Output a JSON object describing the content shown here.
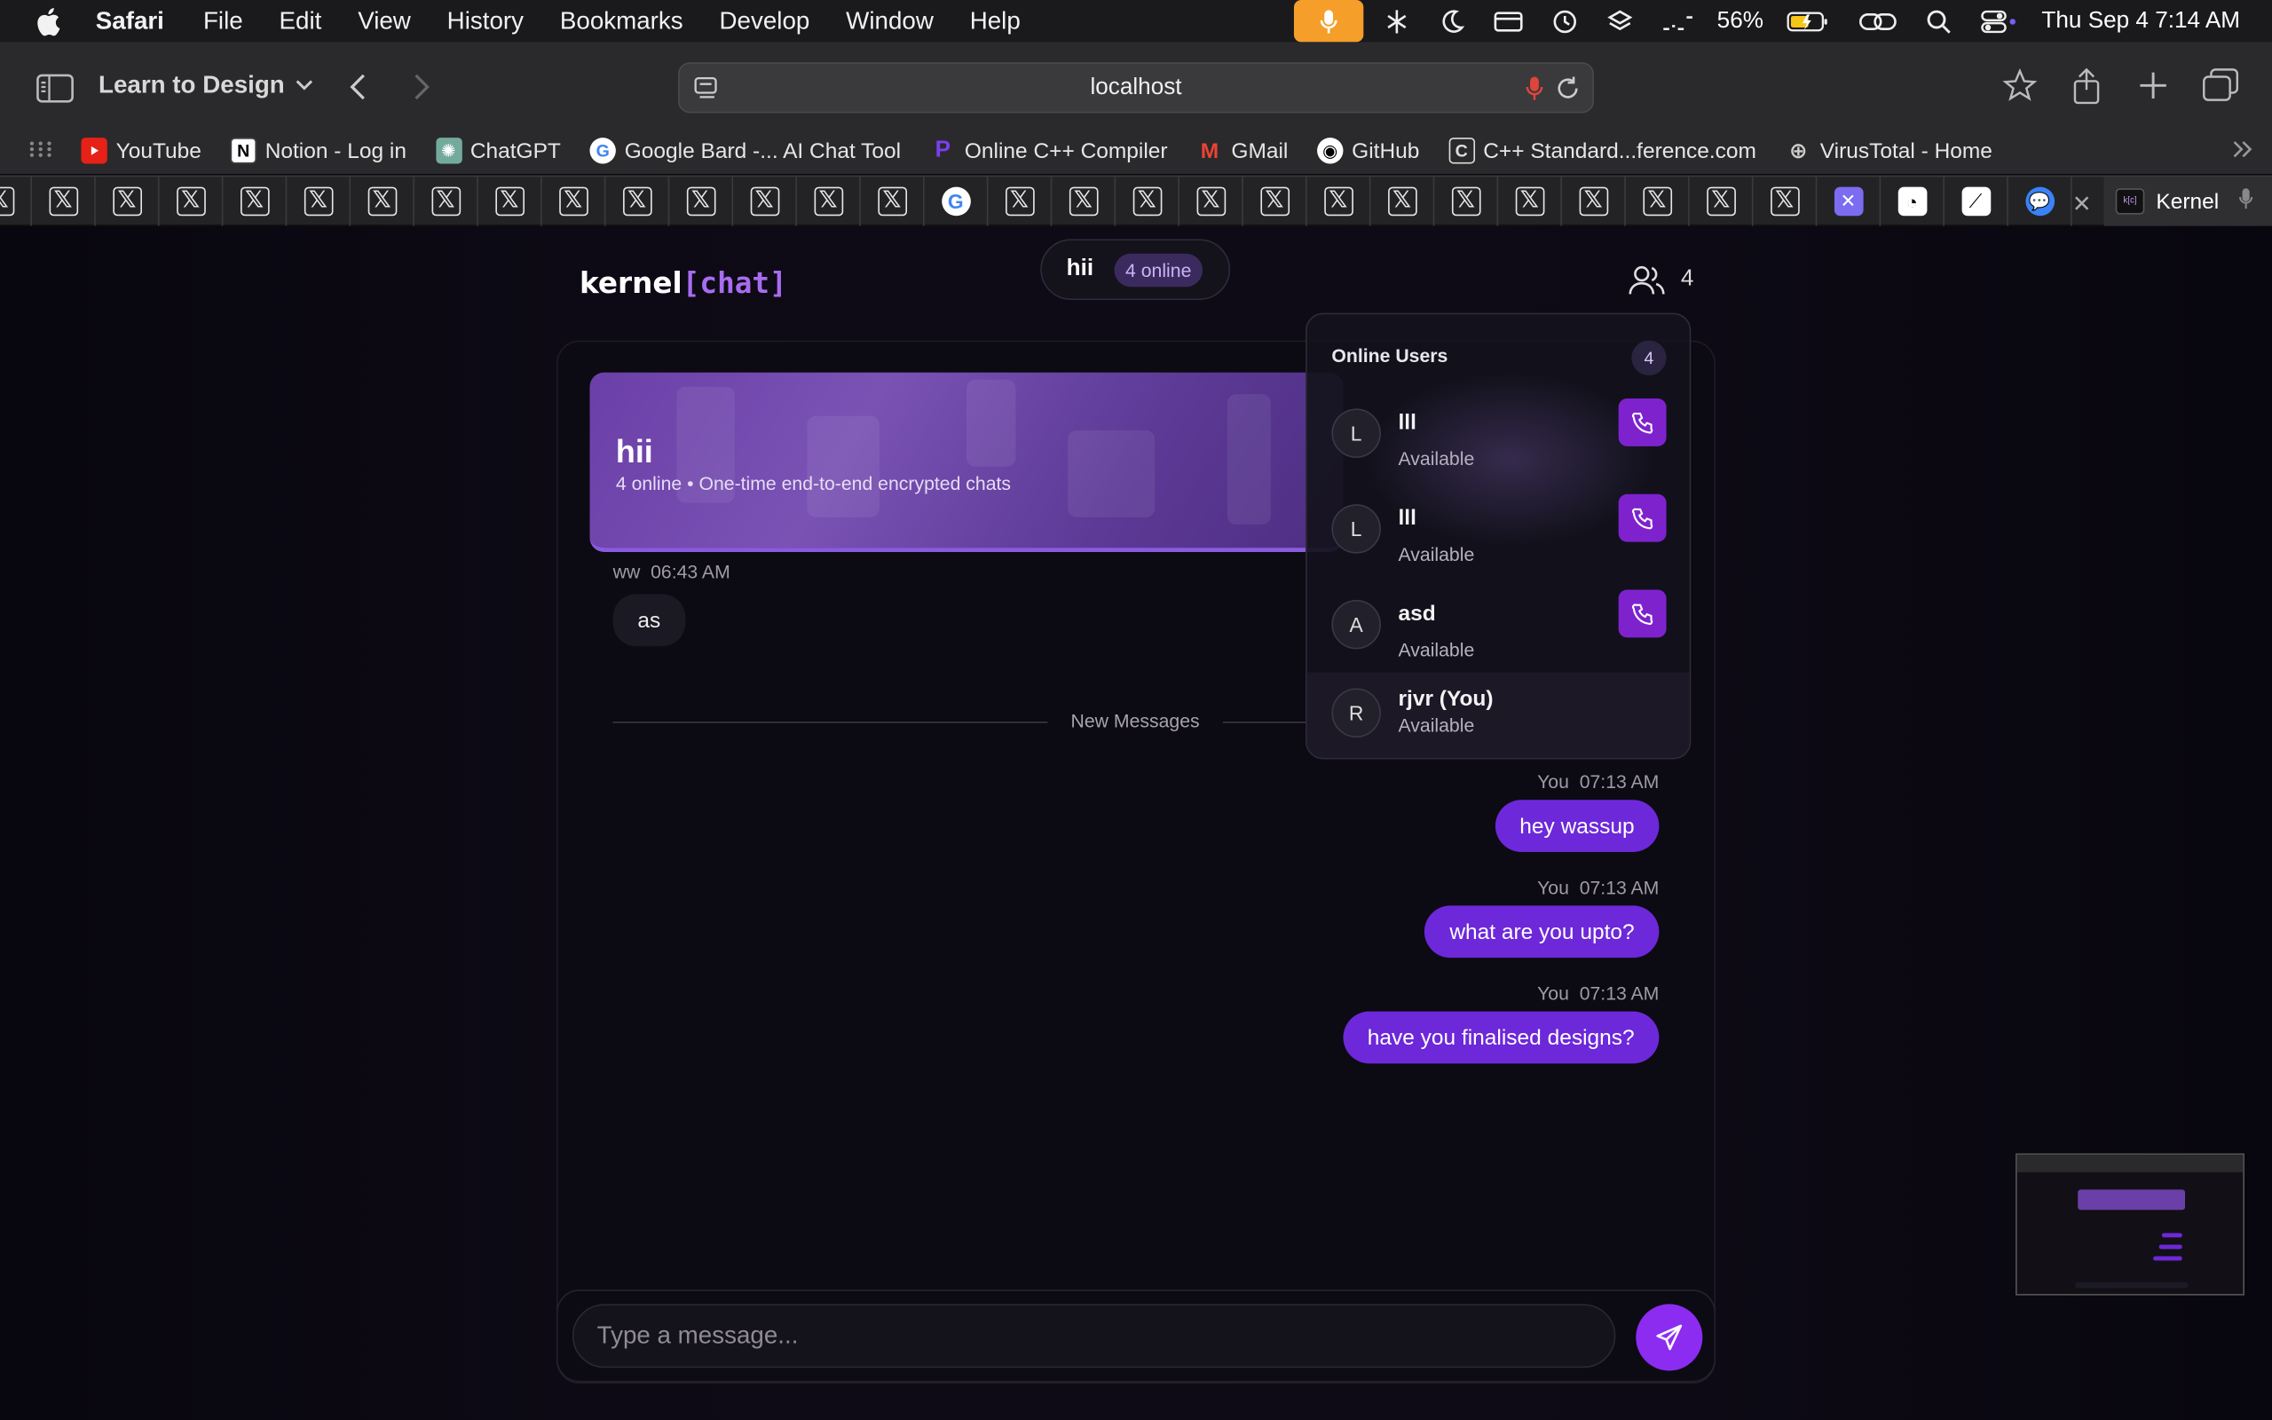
{
  "menubar": {
    "app": "Safari",
    "items": [
      "File",
      "Edit",
      "View",
      "History",
      "Bookmarks",
      "Develop",
      "Window",
      "Help"
    ],
    "battery": "56%",
    "datetime": "Thu Sep 4  7:14 AM"
  },
  "toolbar": {
    "tab_group": "Learn to Design",
    "url": "localhost"
  },
  "bookmarks": [
    {
      "label": "YouTube",
      "icon": "youtube-icon",
      "color": "#e62117"
    },
    {
      "label": "Notion - Log in",
      "icon": "notion-icon",
      "color": "#ffffff"
    },
    {
      "label": "ChatGPT",
      "icon": "chatgpt-icon",
      "color": "#74aa9c"
    },
    {
      "label": "Google Bard -... AI Chat Tool",
      "icon": "google-icon",
      "color": "#ffffff"
    },
    {
      "label": "Online C++ Compiler",
      "icon": "compiler-icon",
      "color": "#7b3ff2"
    },
    {
      "label": "GMail",
      "icon": "gmail-icon",
      "color": "#ea4335"
    },
    {
      "label": "GitHub",
      "icon": "github-icon",
      "color": "#ffffff"
    },
    {
      "label": "C++ Standard...ference.com",
      "icon": "cppref-icon",
      "color": "#ffffff"
    },
    {
      "label": "VirusTotal - Home",
      "icon": "globe-icon",
      "color": "#cccccc"
    }
  ],
  "active_tab": {
    "label": "Kernel"
  },
  "app": {
    "brand_main": "kernel",
    "brand_accent": "[chat]",
    "room_name": "hii",
    "room_online": "4 online",
    "users_count": "4"
  },
  "banner": {
    "title": "hii",
    "subtitle": "4 online • One-time end-to-end encrypted chats"
  },
  "messages": {
    "incoming": {
      "sender": "ww",
      "time": "06:43 AM",
      "text": "as"
    },
    "divider": "New Messages",
    "outgoing": [
      {
        "sender": "You",
        "time": "07:13 AM",
        "text": "hey wassup"
      },
      {
        "sender": "You",
        "time": "07:13 AM",
        "text": "what are you upto?"
      },
      {
        "sender": "You",
        "time": "07:13 AM",
        "text": "have you finalised designs?"
      }
    ]
  },
  "composer": {
    "placeholder": "Type a message..."
  },
  "online_users": {
    "title": "Online Users",
    "count": "4",
    "users": [
      {
        "initial": "L",
        "name": "lll",
        "status": "Available"
      },
      {
        "initial": "L",
        "name": "lll",
        "status": "Available"
      },
      {
        "initial": "A",
        "name": "asd",
        "status": "Available"
      },
      {
        "initial": "R",
        "name": "rjvr (You)",
        "status": "Available"
      }
    ]
  },
  "colors": {
    "accent": "#7e22ce",
    "bubble": "#6d28d9",
    "send": "#8b2cf0"
  }
}
